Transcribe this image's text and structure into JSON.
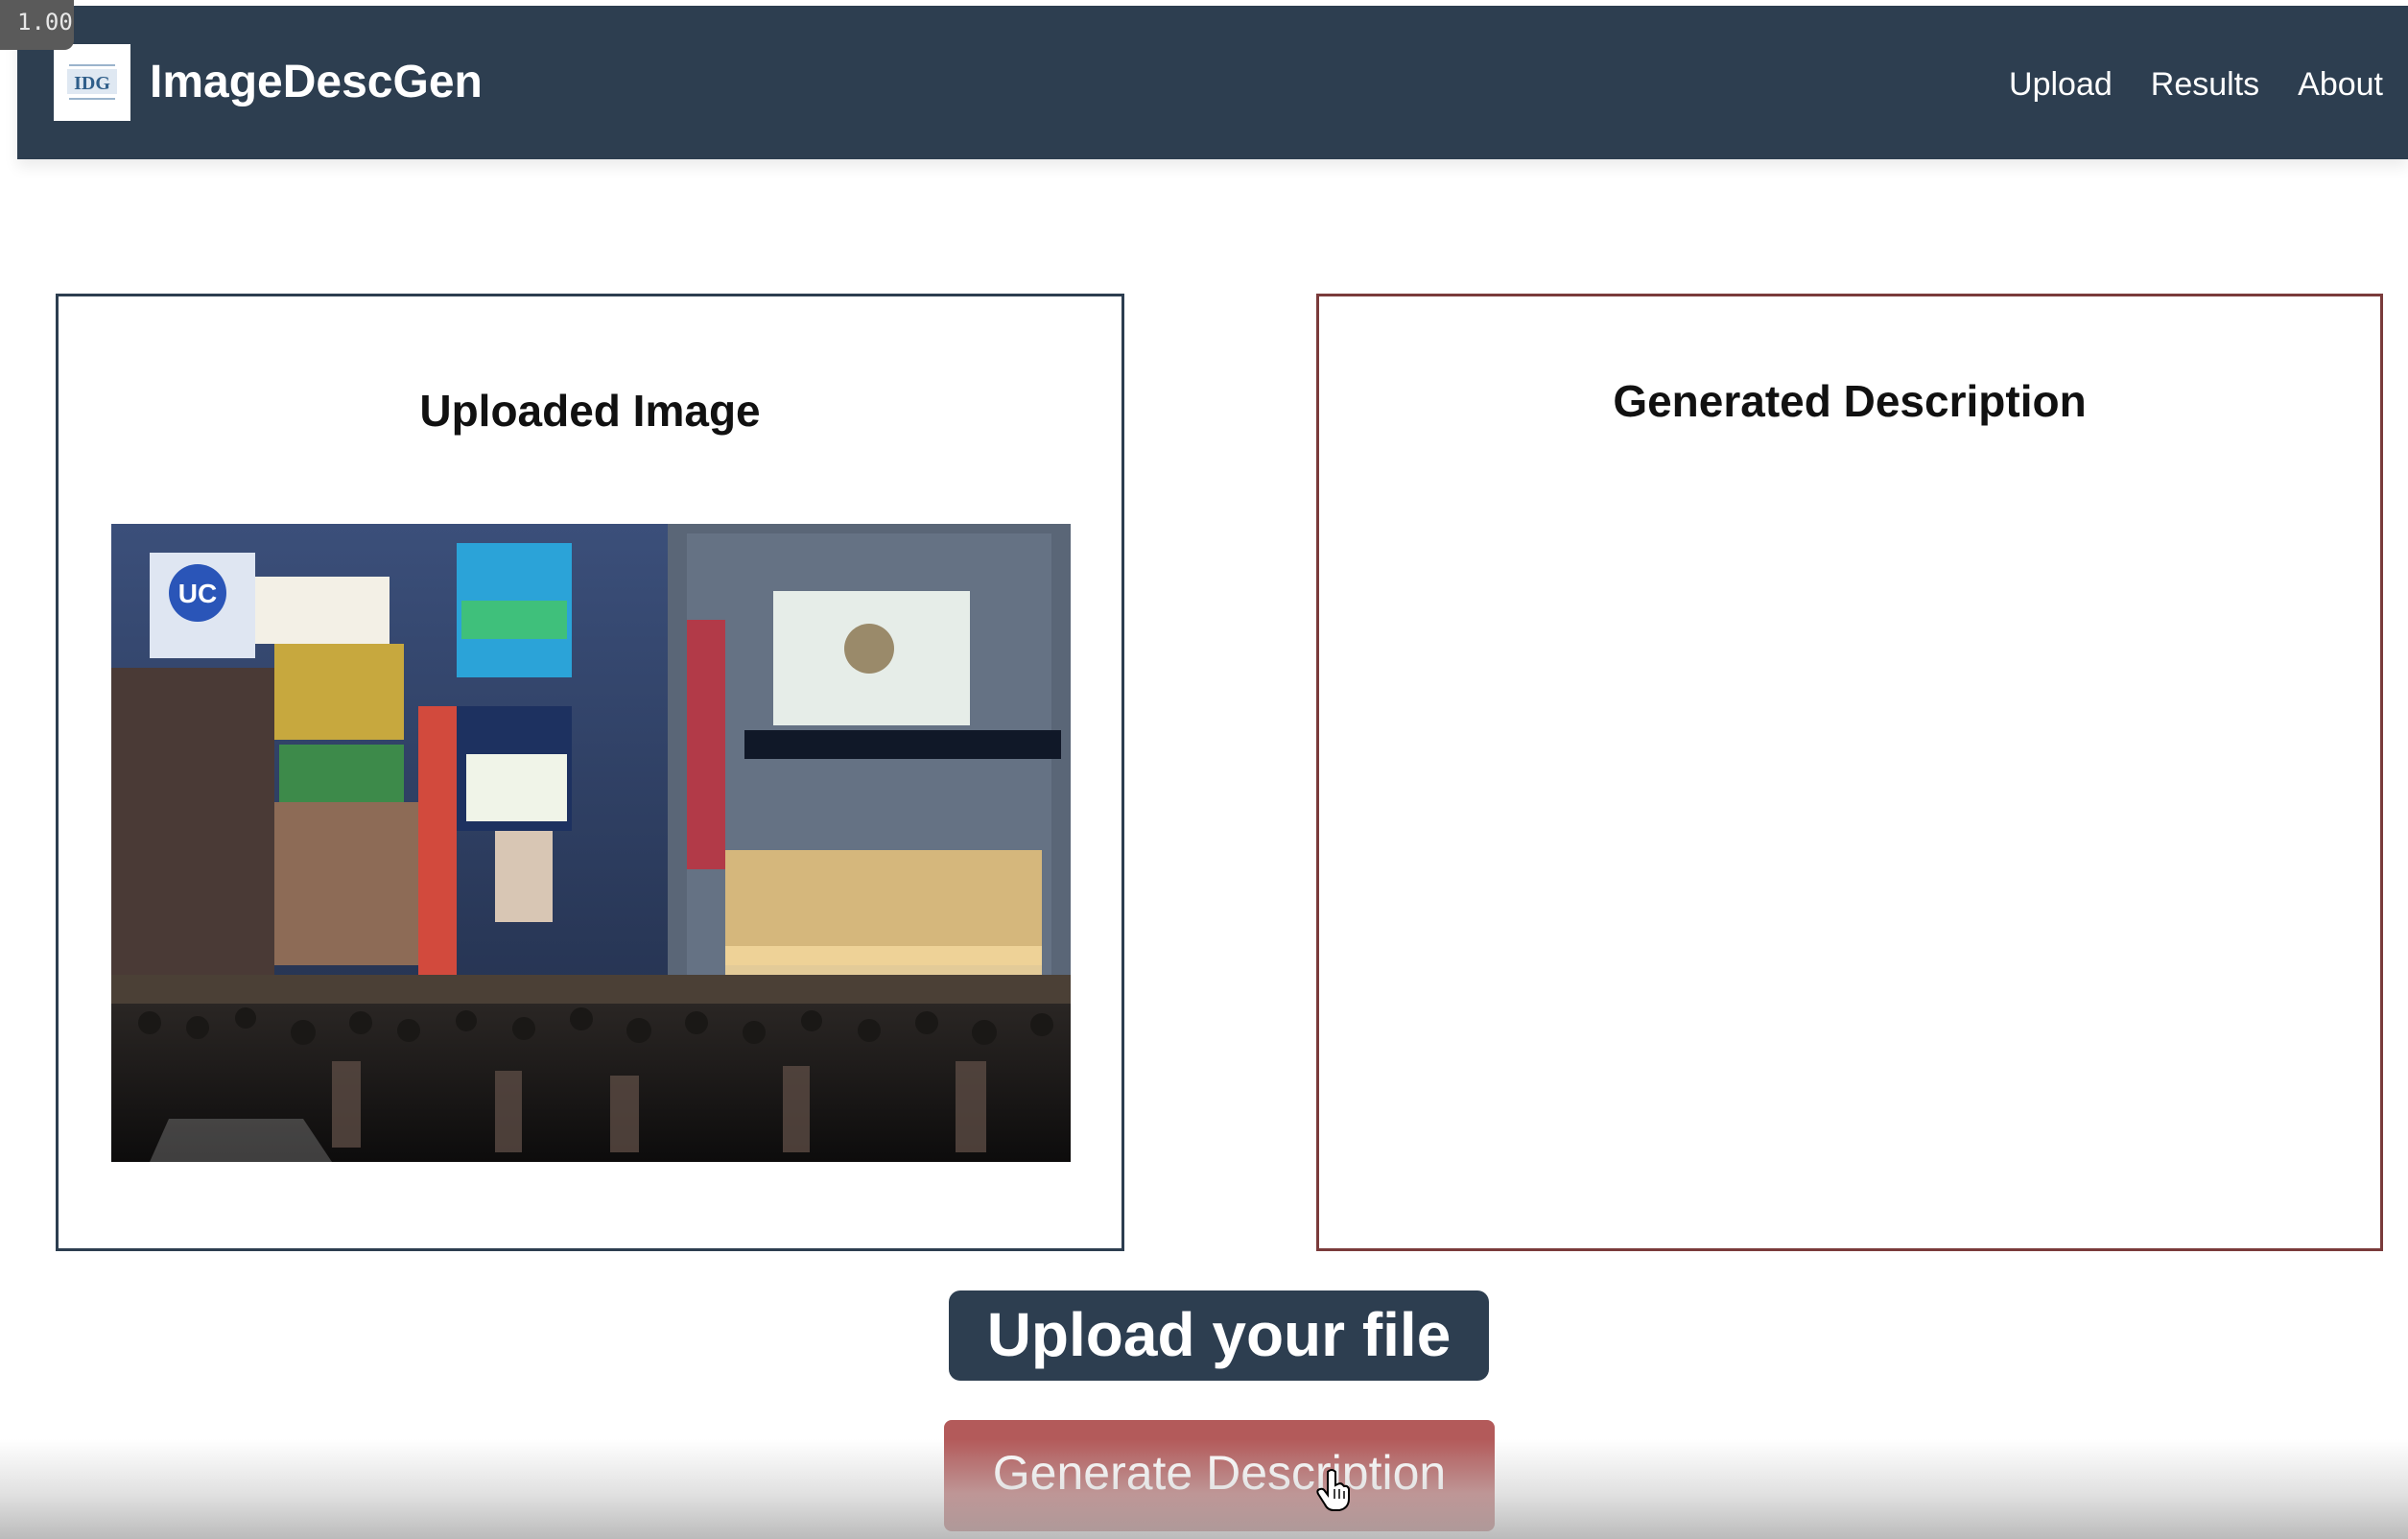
{
  "zoom_badge": "1.00",
  "app": {
    "brand": "ImageDescGen",
    "logo_text": "IDG"
  },
  "nav": {
    "items": [
      {
        "label": "Upload"
      },
      {
        "label": "Results"
      },
      {
        "label": "About"
      }
    ]
  },
  "panels": {
    "uploaded": {
      "title": "Uploaded Image",
      "image_subject": "night city street crossing with neon billboards"
    },
    "generated": {
      "title": "Generated Description",
      "text": ""
    }
  },
  "actions": {
    "upload_label": "Upload your file",
    "generate_label": "Generate Description"
  },
  "colors": {
    "navbar": "#2d3e50",
    "generate_button": "#b35a5a",
    "right_panel_border": "#7a3b3b"
  }
}
